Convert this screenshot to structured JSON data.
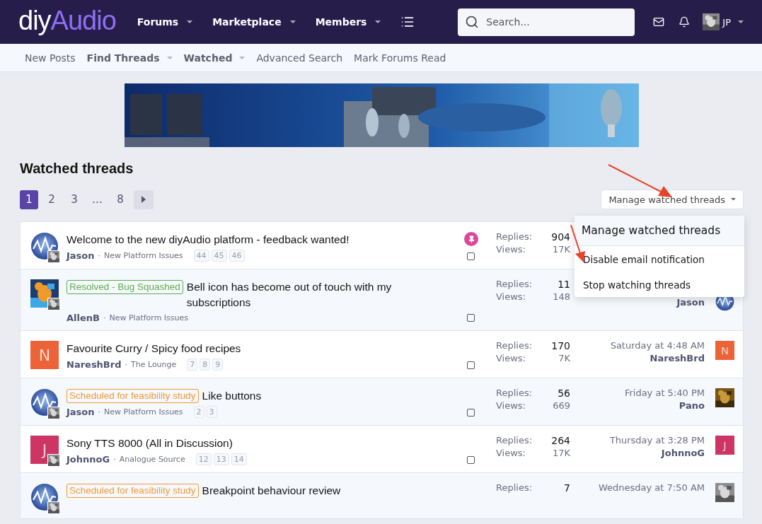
{
  "header": {
    "logo": {
      "first": "diy",
      "second": "Audio"
    },
    "nav": [
      {
        "label": "Forums",
        "dropdown": true
      },
      {
        "label": "Marketplace",
        "dropdown": true
      },
      {
        "label": "Members",
        "dropdown": true
      }
    ],
    "search": {
      "placeholder": "Search..."
    },
    "user": {
      "initials": "JP",
      "avatar": {
        "kind": "picture"
      }
    }
  },
  "subnav": [
    {
      "label": "New Posts",
      "dropdown": false
    },
    {
      "label": "Find Threads",
      "dropdown": true
    },
    {
      "label": "Watched",
      "dropdown": true
    },
    {
      "label": "Advanced Search",
      "dropdown": false
    },
    {
      "label": "Mark Forums Read",
      "dropdown": false
    }
  ],
  "banner": {
    "kind": "picture"
  },
  "page_title": "Watched threads",
  "pagination": [
    {
      "label": "1",
      "selected": true
    },
    {
      "label": "2",
      "selected": false
    },
    {
      "label": "3",
      "selected": false
    },
    {
      "label": "…",
      "selected": false
    },
    {
      "label": "8",
      "selected": false
    }
  ],
  "manage_button": "Manage watched threads",
  "menu": {
    "title": "Manage watched threads",
    "items": [
      "Disable email notification",
      "Stop watching threads"
    ]
  },
  "threads": [
    {
      "avatar": {
        "kind": "wave"
      },
      "posted": true,
      "title": "Welcome to the new diyAudio platform - feedback wanted!",
      "author": "Jason",
      "separator": "·",
      "forum": "New Platform Issues",
      "pages": [
        "44",
        "45",
        "46"
      ],
      "pinned": true,
      "checked": false,
      "replies_label": "Replies:",
      "replies": "904",
      "views_label": "Views:",
      "views": "17K"
    },
    {
      "avatar": {
        "kind": "picture"
      },
      "posted": true,
      "prefix": {
        "text": "Resolved - Bug Squashed",
        "color": "#5cae4f"
      },
      "title": "Bell icon has become out of touch with my subscriptions",
      "author": "AllenB",
      "separator": "·",
      "forum": "New Platform Issues",
      "pinned": false,
      "checked": false,
      "replies_label": "Replies:",
      "replies": "11",
      "views_label": "Views:",
      "views": "148",
      "latest": {
        "user": "Jason"
      },
      "latest_avatar": {
        "kind": "wave"
      }
    },
    {
      "avatar": {
        "kind": "letter",
        "letter": "N",
        "color": "#ec6337"
      },
      "posted": false,
      "title": "Favourite Curry / Spicy food recipes",
      "author": "NareshBrd",
      "separator": "·",
      "forum": "The Lounge",
      "pages": [
        "7",
        "8",
        "9"
      ],
      "pinned": false,
      "checked": false,
      "replies_label": "Replies:",
      "replies": "170",
      "views_label": "Views:",
      "views": "7K",
      "latest": {
        "date": "Saturday at 4:48 AM",
        "user": "NareshBrd"
      },
      "latest_avatar": {
        "kind": "letter",
        "letter": "N",
        "color": "#ec6337"
      }
    },
    {
      "avatar": {
        "kind": "wave"
      },
      "posted": true,
      "prefix": {
        "text": "Scheduled for feasibility study",
        "color": "#f29a35"
      },
      "title": "Like buttons",
      "author": "Jason",
      "separator": "·",
      "forum": "New Platform Issues",
      "pages": [
        "2",
        "3"
      ],
      "pinned": false,
      "checked": false,
      "replies_label": "Replies:",
      "replies": "56",
      "views_label": "Views:",
      "views": "669",
      "latest": {
        "date": "Friday at 5:40 PM",
        "user": "Pano"
      },
      "latest_avatar": {
        "kind": "picture"
      }
    },
    {
      "avatar": {
        "kind": "letter",
        "letter": "J",
        "color": "#cc3564"
      },
      "posted": true,
      "title": "Sony TTS 8000 (All in Discussion)",
      "author": "JohnnoG",
      "separator": "·",
      "forum": "Analogue Source",
      "pages": [
        "12",
        "13",
        "14"
      ],
      "pinned": false,
      "checked": false,
      "replies_label": "Replies:",
      "replies": "264",
      "views_label": "Views:",
      "views": "17K",
      "latest": {
        "date": "Thursday at 3:28 PM",
        "user": "JohnnoG"
      },
      "latest_avatar": {
        "kind": "letter",
        "letter": "J",
        "color": "#cc3564"
      }
    },
    {
      "avatar": {
        "kind": "wave"
      },
      "posted": true,
      "prefix": {
        "text": "Scheduled for feasibility study",
        "color": "#f29a35"
      },
      "title": "Breakpoint behaviour review",
      "replies_label": "Replies:",
      "replies": "7",
      "latest": {
        "date": "Wednesday at 7:50 AM"
      },
      "latest_avatar": {
        "kind": "picture"
      }
    }
  ]
}
